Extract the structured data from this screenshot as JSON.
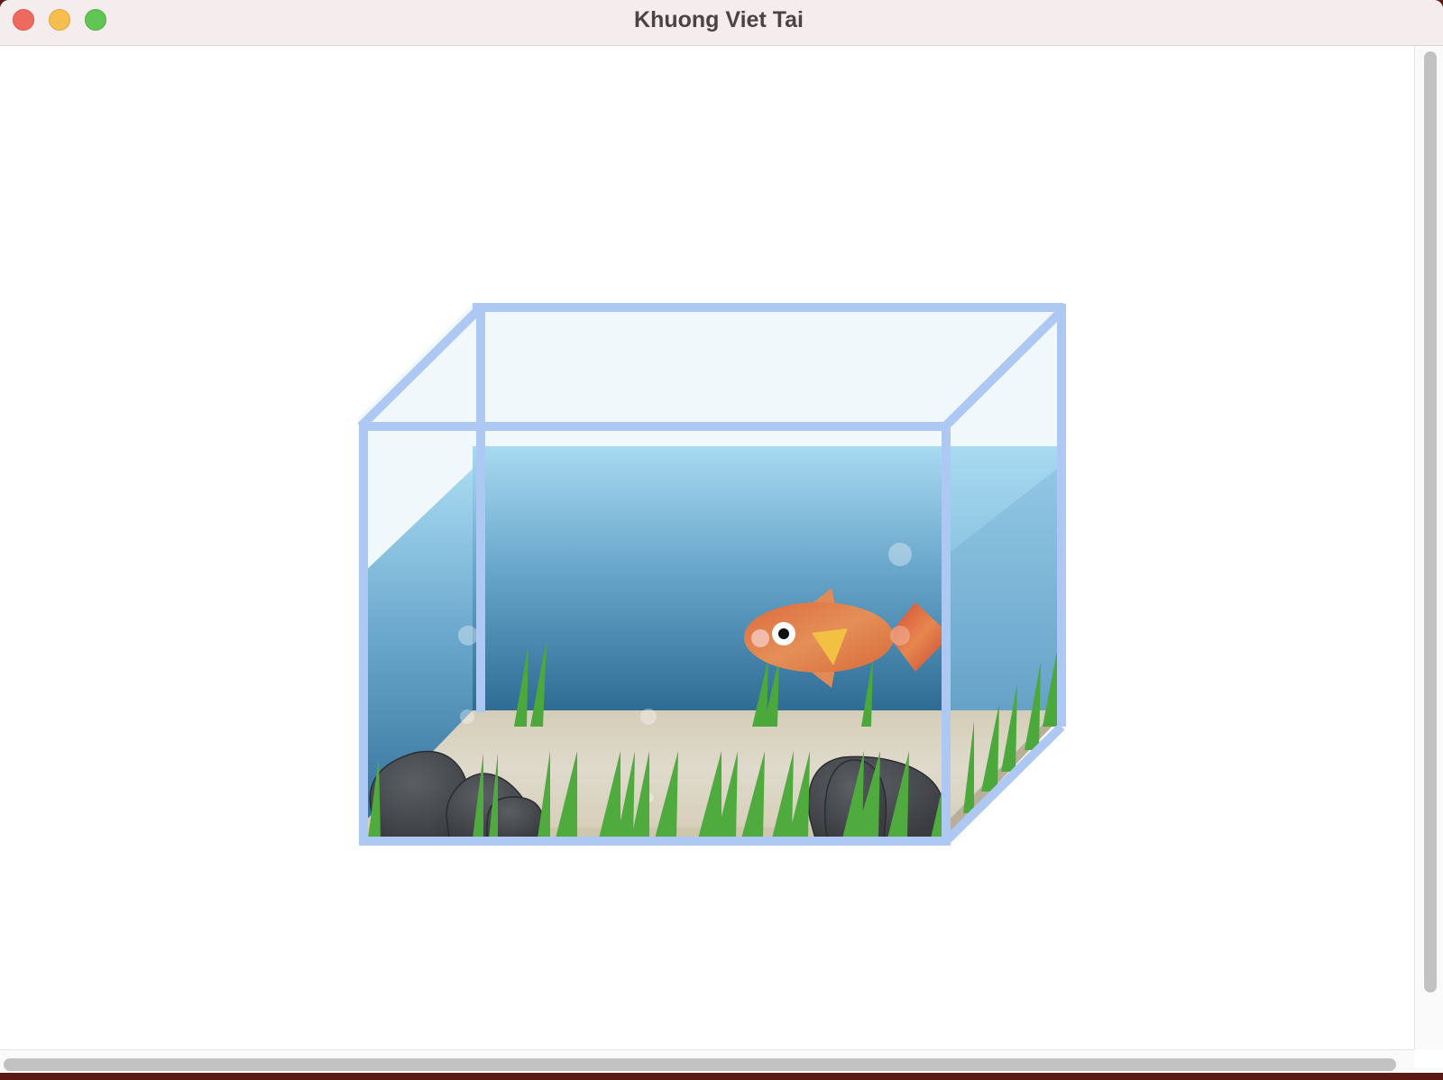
{
  "window": {
    "title": "Khuong Viet Tai",
    "controls": {
      "close": "close-button",
      "minimize": "minimize-button",
      "maximize": "maximize-button"
    }
  },
  "scene": {
    "description_icons": [
      "aquarium-tank",
      "goldfish",
      "seaweed",
      "rocks",
      "bubbles",
      "sand"
    ],
    "colors": {
      "tank_frame": "#aec8f4",
      "air": "#f1f8fc",
      "water_top": "#a6d8f0",
      "water_bottom": "#2f6e96",
      "sand": "#ddd7c6",
      "seaweed": "#4fab3d",
      "rock": "#4a4d52",
      "fish_body": "#e08a55",
      "fish_fin": "#f2c143"
    }
  }
}
